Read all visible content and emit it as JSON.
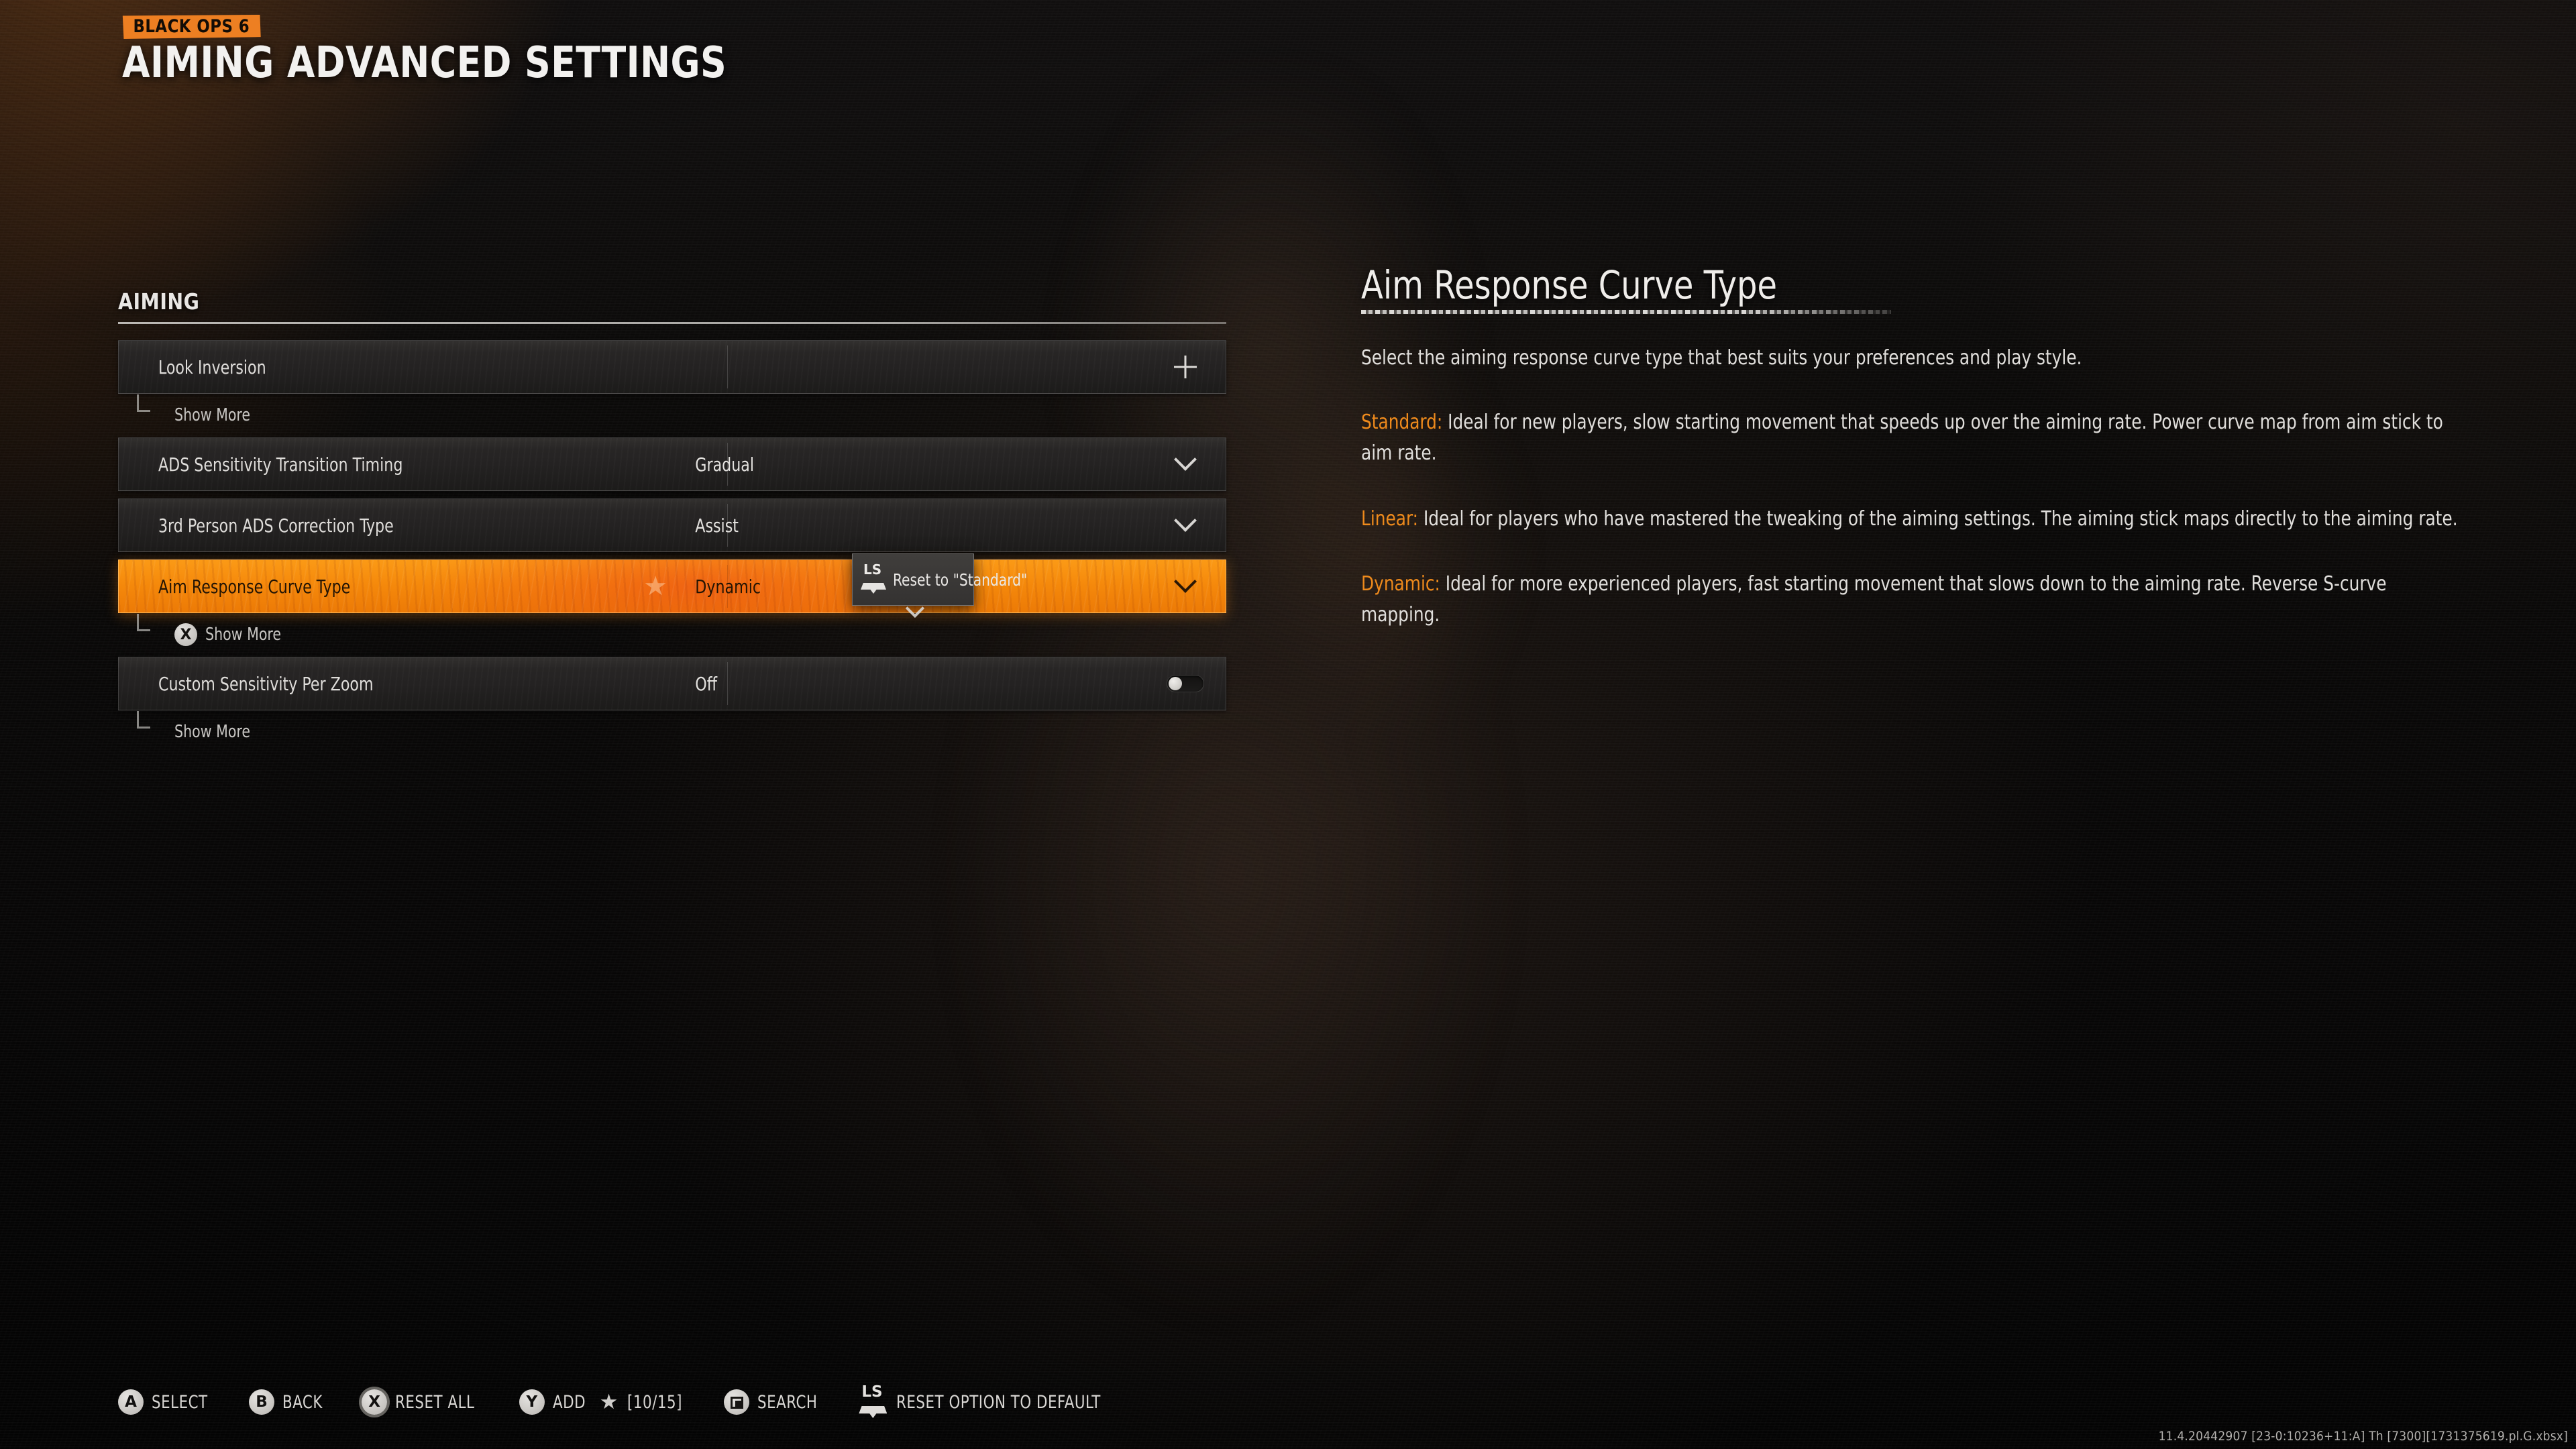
{
  "header": {
    "logo_text": "BLACK OPS 6",
    "page_title": "AIMING ADVANCED SETTINGS"
  },
  "settings": {
    "section_label": "AIMING",
    "rows": [
      {
        "label": "Look Inversion",
        "value": "",
        "control": "plus-icon",
        "selected": false,
        "sub_label": "Show More",
        "sub_badge": ""
      },
      {
        "label": "ADS Sensitivity Transition Timing",
        "value": "Gradual",
        "control": "chevron-down-icon",
        "selected": false,
        "sub_label": "",
        "sub_badge": ""
      },
      {
        "label": "3rd Person ADS Correction Type",
        "value": "Assist",
        "control": "chevron-down-icon",
        "selected": false,
        "sub_label": "",
        "sub_badge": ""
      },
      {
        "label": "Aim Response Curve Type",
        "value": "Dynamic",
        "control": "chevron-down-icon",
        "selected": true,
        "sub_label": "Show More",
        "sub_badge": "X"
      },
      {
        "label": "Custom Sensitivity Per Zoom",
        "value": "Off",
        "control": "toggle-off",
        "selected": false,
        "sub_label": "Show More",
        "sub_badge": ""
      }
    ]
  },
  "reset_tooltip": {
    "button_glyph": "LS",
    "label": "Reset to \"Standard\""
  },
  "info_panel": {
    "title": "Aim Response Curve Type",
    "intro": "Select the aiming response curve type that best suits your preferences and play style.",
    "paragraphs": [
      {
        "term": "Standard:",
        "text": " Ideal for new players, slow starting movement that speeds up over the aiming rate. Power curve map from aim stick to aim rate."
      },
      {
        "term": "Linear:",
        "text": "  Ideal for players who have mastered the tweaking of the aiming settings. The aiming stick maps directly to the aiming rate."
      },
      {
        "term": "Dynamic:",
        "text": " Ideal for more experienced players, fast starting movement that slows down to the aiming rate. Reverse S-curve mapping."
      }
    ]
  },
  "footer": {
    "items": [
      {
        "glyph": "A",
        "label": "SELECT",
        "star": "",
        "count": ""
      },
      {
        "glyph": "B",
        "label": "BACK",
        "star": "",
        "count": ""
      },
      {
        "glyph": "X",
        "label": "RESET ALL",
        "star": "",
        "count": ""
      },
      {
        "glyph": "Y",
        "label": "ADD",
        "star": "★",
        "count": "[10/15]"
      },
      {
        "glyph": "",
        "label": "SEARCH",
        "star": "",
        "count": ""
      },
      {
        "glyph": "LS",
        "label": "RESET OPTION TO DEFAULT",
        "star": "",
        "count": ""
      }
    ]
  },
  "build_string": "11.4.20442907 [23-0:10236+11:A] Th [7300][1731375619.pl.G.xbsx]",
  "colors": {
    "accent_orange": "#F08A0C",
    "logo_orange": "#ED7F22",
    "term_orange": "#EE8A1C",
    "row_bg": "#262423",
    "text_light": "#E0DEDB"
  }
}
